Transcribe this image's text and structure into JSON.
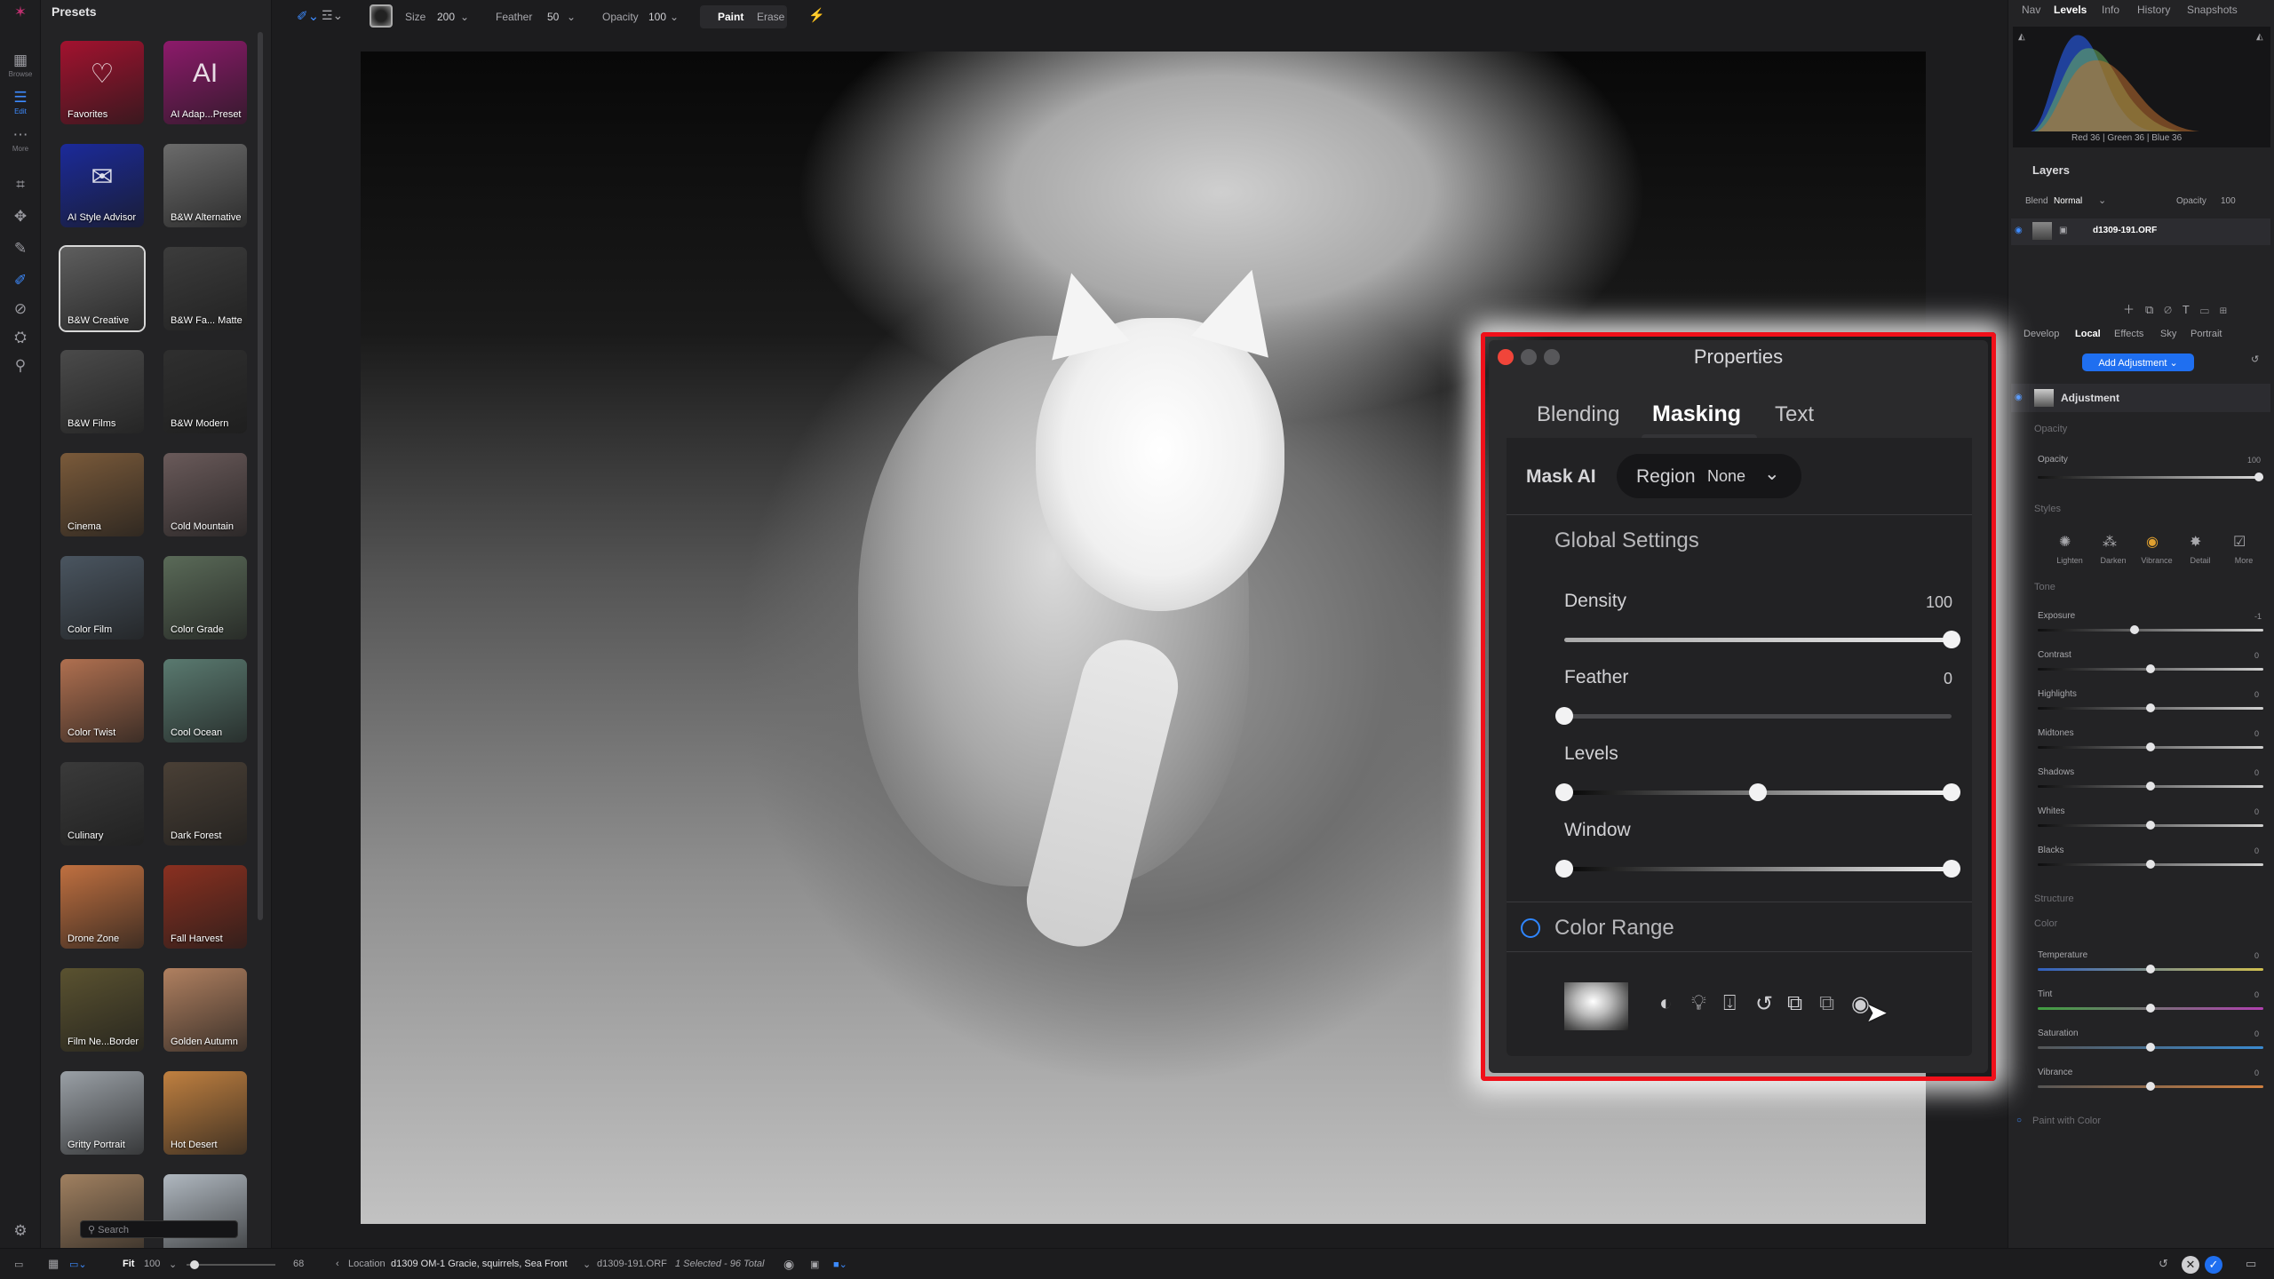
{
  "left_tools": [
    {
      "icon": "grid-icon",
      "label": "Browse"
    },
    {
      "icon": "sliders-icon",
      "label": "Edit"
    },
    {
      "icon": "more-icon",
      "label": "More"
    }
  ],
  "presets": {
    "title": "Presets",
    "search_placeholder": "Search",
    "items": [
      {
        "label": "Favorites",
        "color": "#a3122f"
      },
      {
        "label": "AI Adap...Preset",
        "color": "#8d1a6b"
      },
      {
        "label": "AI Style Advisor",
        "color": "#1b2a9a"
      },
      {
        "label": "B&W Alternative",
        "color": "#6b6b6b"
      },
      {
        "label": "B&W Creative",
        "color": "#5e5e5e"
      },
      {
        "label": "B&W Fa... Matte",
        "color": "#3c3c3c"
      },
      {
        "label": "B&W Films",
        "color": "#4a4a4a"
      },
      {
        "label": "B&W Modern",
        "color": "#2f2f2f"
      },
      {
        "label": "Cinema",
        "color": "#7a5a3a"
      },
      {
        "label": "Cold Mountain",
        "color": "#6a5a5a"
      },
      {
        "label": "Color Film",
        "color": "#4a5560"
      },
      {
        "label": "Color Grade",
        "color": "#5a6a58"
      },
      {
        "label": "Color Twist",
        "color": "#b07050"
      },
      {
        "label": "Cool Ocean",
        "color": "#5a7a70"
      },
      {
        "label": "Culinary",
        "color": "#3a3a3a"
      },
      {
        "label": "Dark Forest",
        "color": "#4a4036"
      },
      {
        "label": "Drone Zone",
        "color": "#c07040"
      },
      {
        "label": "Fall Harvest",
        "color": "#8a3020"
      },
      {
        "label": "Film Ne...Border",
        "color": "#5a5230"
      },
      {
        "label": "Golden Autumn",
        "color": "#b08060"
      },
      {
        "label": "Gritty Portrait",
        "color": "#9aa0a6"
      },
      {
        "label": "Hot Desert",
        "color": "#c08040"
      },
      {
        "label": "",
        "color": "#a08060"
      },
      {
        "label": "",
        "color": "#b0b8c0"
      }
    ]
  },
  "topbar": {
    "size_label": "Size",
    "size_value": "200",
    "feather_label": "Feather",
    "feather_value": "50",
    "opacity_label": "Opacity",
    "opacity_value": "100",
    "paint": "Paint",
    "erase": "Erase"
  },
  "right": {
    "tabs": [
      "Nav",
      "Levels",
      "Info",
      "History",
      "Snapshots"
    ],
    "active_tab": "Levels",
    "histo_readout": "Red  36  | Green  36  | Blue  36",
    "layers_title": "Layers",
    "blend_label": "Blend",
    "blend_value": "Normal",
    "opacity_label": "Opacity",
    "opacity_value": "100",
    "layer_name": "d1309-191.ORF",
    "module_tabs": [
      "Develop",
      "Local",
      "Effects",
      "Sky",
      "Portrait"
    ],
    "add_adjustment": "Add Adjustment",
    "adjustment_title": "Adjustment",
    "opacity_section": "Opacity",
    "opacity_slider_label": "Opacity",
    "opacity_slider_value": "100",
    "styles_label": "Styles",
    "styles": [
      "Lighten",
      "Darken",
      "Vibrance",
      "Detail",
      "More"
    ],
    "tone_label": "Tone",
    "tone": [
      {
        "label": "Exposure",
        "value": "-1",
        "pos": 0.43
      },
      {
        "label": "Contrast",
        "value": "0",
        "pos": 0.5
      },
      {
        "label": "Highlights",
        "value": "0",
        "pos": 0.5
      },
      {
        "label": "Midtones",
        "value": "0",
        "pos": 0.5
      },
      {
        "label": "Shadows",
        "value": "0",
        "pos": 0.5
      },
      {
        "label": "Whites",
        "value": "0",
        "pos": 0.5
      },
      {
        "label": "Blacks",
        "value": "0",
        "pos": 0.5
      }
    ],
    "structure_label": "Structure",
    "color_label": "Color",
    "color": [
      {
        "label": "Temperature",
        "value": "0",
        "pos": 0.5
      },
      {
        "label": "Tint",
        "value": "0",
        "pos": 0.5
      },
      {
        "label": "Saturation",
        "value": "0",
        "pos": 0.5
      },
      {
        "label": "Vibrance",
        "value": "0",
        "pos": 0.5
      }
    ],
    "paint_with_color": "Paint with Color"
  },
  "properties": {
    "title": "Properties",
    "tabs": [
      "Blending",
      "Masking",
      "Text"
    ],
    "active_tab": "Masking",
    "mask_ai": "Mask AI",
    "region_label": "Region",
    "region_value": "None",
    "global_settings": "Global Settings",
    "density_label": "Density",
    "density_value": "100",
    "density_level": 1.0,
    "feather_label": "Feather",
    "feather_value": "0",
    "feather_level": 0.0,
    "levels_label": "Levels",
    "levels_points": [
      0.0,
      0.5,
      1.0
    ],
    "window_label": "Window",
    "window_points": [
      0.0,
      1.0
    ],
    "color_range": "Color Range",
    "tool_icons": [
      "invert-mask-icon",
      "bulb-icon",
      "pin-icon",
      "reset-icon",
      "copy-mask-icon",
      "paste-mask-icon",
      "view-mask-icon"
    ]
  },
  "bottom": {
    "fit": "Fit",
    "zoom": "100",
    "thumb_size": "68",
    "location_label": "Location",
    "path": "d1309 OM-1 Gracie, squirrels, Sea Front",
    "filename": "d1309-191.ORF",
    "selection": "1 Selected - 96 Total"
  },
  "colors": {
    "highlight": "#f0101a",
    "accent": "#1f6ff0"
  }
}
